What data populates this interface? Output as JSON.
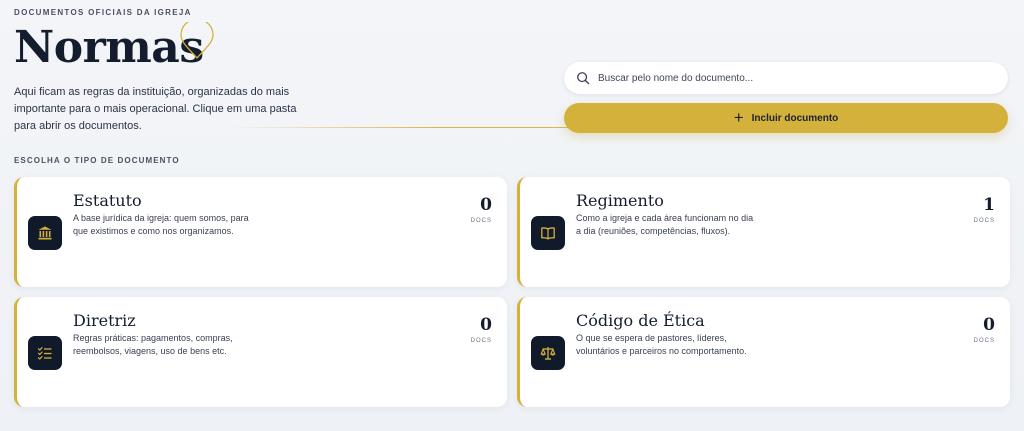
{
  "header": {
    "eyebrow": "DOCUMENTOS OFICIAIS DA IGREJA",
    "title": "Normas",
    "description": "Aqui ficam as regras da instituição, organizadas do mais importante para o mais operacional. Clique em uma pasta para abrir os documentos."
  },
  "search": {
    "placeholder": "Buscar pelo nome do documento..."
  },
  "actions": {
    "add_label": "Incluir documento"
  },
  "section": {
    "label": "ESCOLHA O TIPO DE DOCUMENTO"
  },
  "cards": [
    {
      "title": "Estatuto",
      "description": "A base jurídica da igreja: quem somos, para que existimos e como nos organizamos.",
      "count": "0",
      "count_unit": "DOCS",
      "icon": "institution-icon"
    },
    {
      "title": "Regimento",
      "description": "Como a igreja e cada área funcionam no dia a dia (reuniões, competências, fluxos).",
      "count": "1",
      "count_unit": "DOCS",
      "icon": "book-icon"
    },
    {
      "title": "Diretriz",
      "description": "Regras práticas: pagamentos, compras, reembolsos, viagens, uso de bens etc.",
      "count": "0",
      "count_unit": "DOCS",
      "icon": "checklist-icon"
    },
    {
      "title": "Código de Ética",
      "description": "O que se espera de pastores, líderes, voluntários e parceiros no comportamento.",
      "count": "0",
      "count_unit": "DOCS",
      "icon": "scales-icon"
    }
  ],
  "colors": {
    "accent": "#d4b13a",
    "icon_bg": "#111a2b",
    "title": "#141d2e"
  }
}
